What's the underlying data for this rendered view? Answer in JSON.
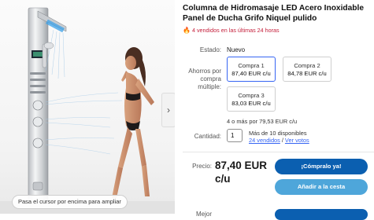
{
  "gallery": {
    "zoom_hint": "Pasa el cursor por encima para ampliar",
    "next_arrow": "›"
  },
  "listing": {
    "title": "Columna de Hidromasaje LED Acero Inoxidable Panel de Ducha Grifo Niquel pulido",
    "sold_text": "4 vendidos en las últimas 24 horas",
    "condition_label": "Estado:",
    "condition_value": "Nuevo",
    "savings_label": "Ahorros por compra múltiple:",
    "options": [
      {
        "name": "Compra 1",
        "price": "87,40 EUR c/u",
        "selected": true
      },
      {
        "name": "Compra 2",
        "price": "84,78 EUR c/u",
        "selected": false
      },
      {
        "name": "Compra 3",
        "price": "83,03 EUR c/u",
        "selected": false
      }
    ],
    "bulk_text": "4 o más por 79,53 EUR c/u",
    "quantity_label": "Cantidad:",
    "quantity_value": "1",
    "available_text": "Más de 10 disponibles",
    "sold_link": "24 vendidos",
    "separator": "/",
    "ratings_link": "Ver votos",
    "price_label": "Precio:",
    "price_value": "87,40 EUR c/u",
    "buy_now_label": "¡Cómpralo ya!",
    "add_to_cart_label": "Añadir a la cesta",
    "best_offer_label": "Mejor"
  },
  "colors": {
    "accent": "#3665f3",
    "buy_button": "#0b5fb0",
    "cart_button": "#4ea6da",
    "urgency": "#c41e3a"
  }
}
